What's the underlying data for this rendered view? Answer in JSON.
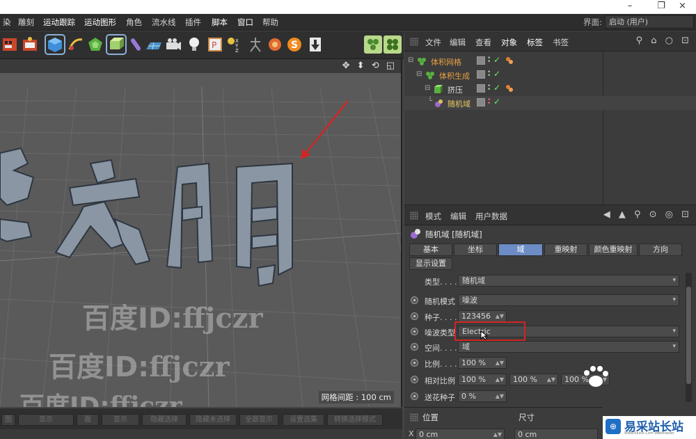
{
  "window": {
    "minimize": "–",
    "restore": "❐",
    "close": "×"
  },
  "menubar": {
    "items": [
      "染",
      "雕刻",
      "运动跟踪",
      "运动图形",
      "角色",
      "流水线",
      "插件",
      "脚本",
      "窗口",
      "帮助"
    ],
    "layout_label": "界面:",
    "layout_value": "启动 (用户)"
  },
  "toolbar": {
    "icons": [
      "render-settings-icon",
      "render-active-view-icon",
      "cube-icon",
      "pen-icon",
      "subdivision-icon",
      "extrude-generator-icon",
      "deformer-icon",
      "floor-icon",
      "camera-icon",
      "light-icon",
      "tag-icon",
      "xyz-icon",
      "figure-icon",
      "scene-icon",
      "s-plugin-icon",
      "import-icon",
      "volume-builder-icon",
      "volume-mesher-icon"
    ]
  },
  "viewport": {
    "nav_icons": "✥ ⬍ ⟲ ◱",
    "grid_spacing": "网格间距 : 100 cm",
    "watermarks": [
      {
        "prefix": "百度ID:",
        "text": "ffjczr"
      },
      {
        "prefix": "百度ID:",
        "text": "ffjczr"
      },
      {
        "prefix": "百度ID:",
        "text": "ffjczr"
      }
    ],
    "scene_text": "文明"
  },
  "bottom_strip": {
    "buttons": [
      "图",
      "显示",
      "面",
      "显示",
      "隐藏选择",
      "隐藏未选择",
      "全部显示",
      "设置选集",
      "转换选择模式"
    ]
  },
  "object_manager": {
    "menu": [
      "文件",
      "编辑",
      "查看",
      "对象",
      "标签",
      "书签"
    ],
    "highlighted": [
      "对象",
      "标签"
    ],
    "header_icons": "⚲ ⌂ ○ ⊡",
    "tree": [
      {
        "name": "体积网格",
        "color": "#e8a040",
        "depth": 0,
        "tag": true
      },
      {
        "name": "体积生成",
        "color": "#e8a040",
        "depth": 1,
        "tag": false
      },
      {
        "name": "挤压",
        "color": "#dcdcdc",
        "depth": 2,
        "tag": true
      },
      {
        "name": "随机域",
        "color": "#e8c860",
        "depth": 3,
        "tag": false
      }
    ]
  },
  "attribute_manager": {
    "menu": [
      "模式",
      "编辑",
      "用户数据"
    ],
    "header_icons": "◀ ▲ ⚲ ⊙ ◎ ⊡",
    "object_title": "随机域 [随机域]",
    "tabs": [
      "基本",
      "坐标",
      "域",
      "重映射",
      "颜色重映射",
      "方向"
    ],
    "active_tab": "域",
    "tab_row2": "显示设置",
    "params": {
      "type_label": "类型. . . .",
      "type_value": "随机域",
      "mode_label": "随机模式",
      "mode_value": "噪波",
      "seed_label": "种子. . . .",
      "seed_value": "123456",
      "noise_type_label": "噪波类型",
      "noise_type_value": "Electric",
      "space_label": "空间. . . .",
      "space_value": "域",
      "scale_label": "比例. . . .",
      "scale_value": "100 %",
      "rel_scale_label": "相对比例",
      "rel_scale_values": [
        "100 %",
        "100 %",
        "100 %"
      ],
      "sparkle_label": "送花种子",
      "sparkle_value": "0 %"
    }
  },
  "coord_panel": {
    "position_label": "位置",
    "size_label": "尺寸",
    "x_label": "X",
    "x_value": "0 cm",
    "x2_value": "0 cm"
  },
  "logo": {
    "text": "易采站长站",
    "sub": "Www.Easck.Com Webmaster"
  }
}
